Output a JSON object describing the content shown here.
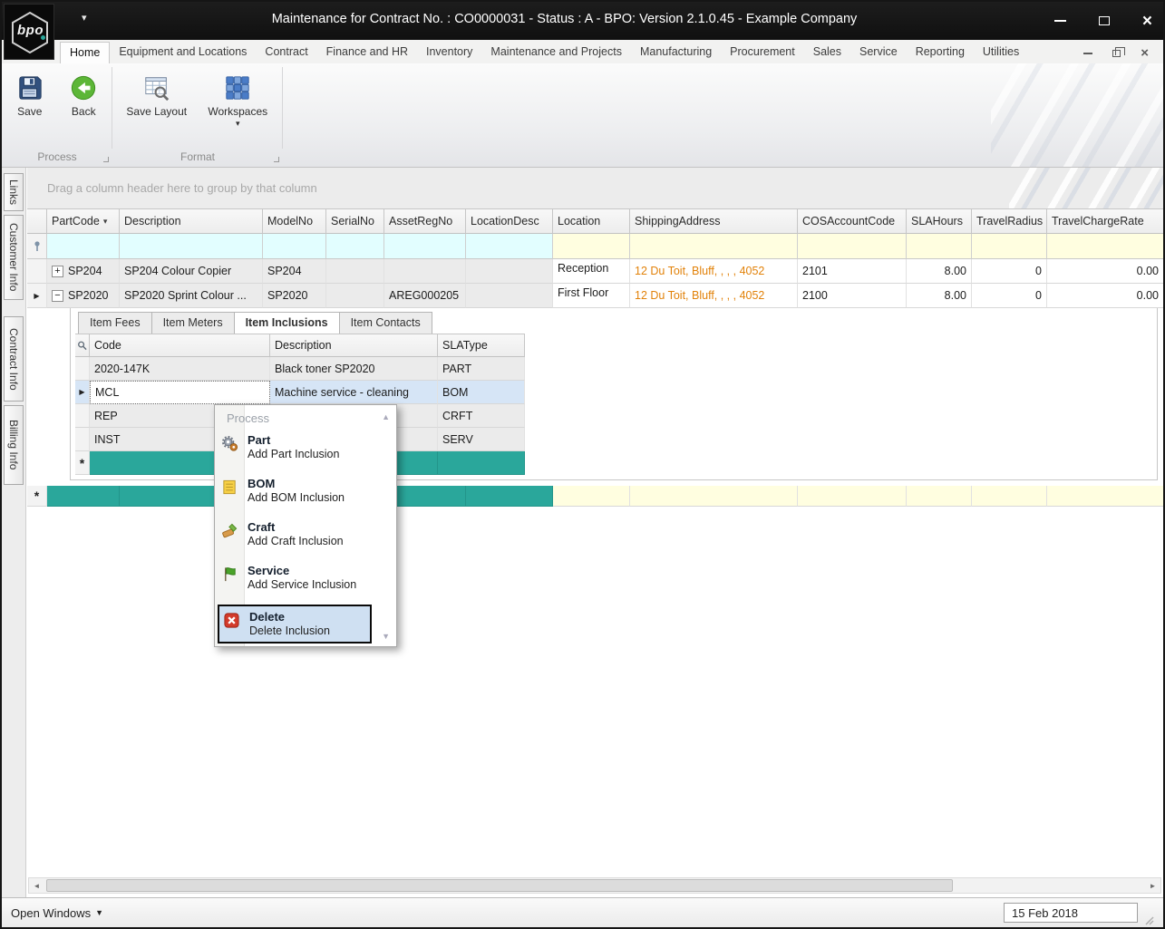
{
  "window": {
    "title": "Maintenance for Contract No. : CO0000031 - Status : A - BPO: Version 2.1.0.45 - Example Company",
    "logo_text": "bpo"
  },
  "menubar": {
    "active_tab": "Home",
    "tabs": [
      {
        "label": "Home"
      },
      {
        "label": "Equipment and Locations"
      },
      {
        "label": "Contract"
      },
      {
        "label": "Finance and HR"
      },
      {
        "label": "Inventory"
      },
      {
        "label": "Maintenance and Projects"
      },
      {
        "label": "Manufacturing"
      },
      {
        "label": "Procurement"
      },
      {
        "label": "Sales"
      },
      {
        "label": "Service"
      },
      {
        "label": "Reporting"
      },
      {
        "label": "Utilities"
      }
    ]
  },
  "ribbon": {
    "save": "Save",
    "back": "Back",
    "save_layout": "Save Layout",
    "workspaces": "Workspaces",
    "groups": {
      "process": "Process",
      "format": "Format"
    }
  },
  "sidebar": {
    "links": "Links",
    "customer_info": "Customer Info",
    "contract_info": "Contract Info",
    "billing_info": "Billing Info"
  },
  "grid": {
    "group_hint": "Drag a column header here to group by that column",
    "columns": [
      "PartCode",
      "Description",
      "ModelNo",
      "SerialNo",
      "AssetRegNo",
      "LocationDesc",
      "Location",
      "ShippingAddress",
      "COSAccountCode",
      "SLAHours",
      "TravelRadius",
      "TravelChargeRate"
    ],
    "rows": [
      {
        "expand": "+",
        "cells": [
          "SP204",
          "SP204 Colour Copier",
          "SP204",
          "",
          "",
          "",
          "Reception",
          "12 Du Toit, Bluff, , , , 4052",
          "2101",
          "8.00",
          "0",
          "0.00"
        ]
      },
      {
        "expand": "−",
        "cells": [
          "SP2020",
          "SP2020 Sprint Colour ...",
          "SP2020",
          "",
          "AREG000205",
          "",
          "First Floor",
          "12 Du Toit, Bluff, , , , 4052",
          "2100",
          "8.00",
          "0",
          "0.00"
        ]
      }
    ]
  },
  "detail": {
    "active_tab": "Item Inclusions",
    "tabs": [
      {
        "label": "Item Fees"
      },
      {
        "label": "Item Meters"
      },
      {
        "label": "Item Inclusions"
      },
      {
        "label": "Item Contacts"
      }
    ],
    "columns": [
      "Code",
      "Description",
      "SLAType"
    ],
    "rows": [
      {
        "cells": [
          "2020-147K",
          "Black toner SP2020",
          "PART"
        ]
      },
      {
        "cells": [
          "MCL",
          "Machine service - cleaning",
          "BOM"
        ]
      },
      {
        "cells": [
          "REP",
          "",
          "CRFT"
        ]
      },
      {
        "cells": [
          "INST",
          "",
          "SERV"
        ]
      }
    ],
    "selected_row": "MCL"
  },
  "context_menu": {
    "header": "Process",
    "items": [
      {
        "title": "Part",
        "subtitle": "Add Part Inclusion"
      },
      {
        "title": "BOM",
        "subtitle": "Add BOM Inclusion"
      },
      {
        "title": "Craft",
        "subtitle": "Add Craft Inclusion"
      },
      {
        "title": "Service",
        "subtitle": "Add Service Inclusion"
      },
      {
        "title": "Delete",
        "subtitle": "Delete Inclusion"
      }
    ],
    "selected_item": "Delete"
  },
  "statusbar": {
    "open_windows": "Open Windows",
    "date": "15 Feb 2018"
  },
  "icons": {
    "dropdown_caret": "▾",
    "row_indicator": "▶",
    "new_row_marker": "*",
    "close_glyph": "×",
    "scroll_up": "▲",
    "scroll_down": "▼",
    "scroll_left": "◄",
    "scroll_right": "►"
  },
  "colors": {
    "new_row_teal": "#2aa79b",
    "filter_cyan": "#e2feff",
    "filter_yellow": "#fffee0",
    "address_orange": "#e2820a",
    "selection_blue": "#d6e5f6",
    "titlebar_black": "#141414"
  }
}
